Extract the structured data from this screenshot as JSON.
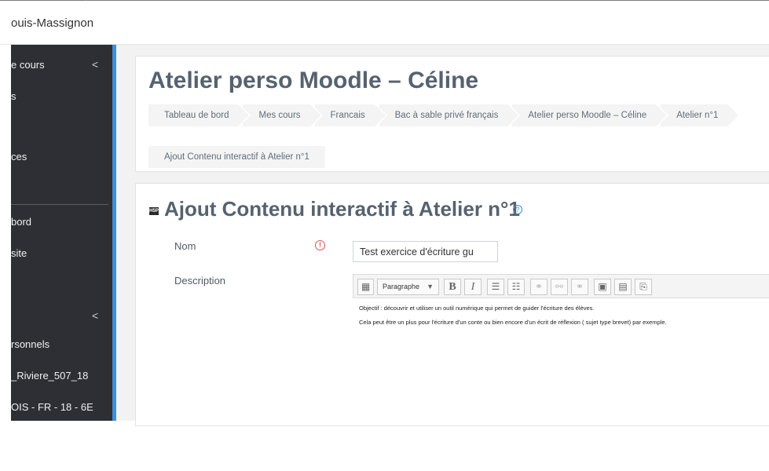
{
  "header": {
    "site_name": "ouis-Massignon"
  },
  "sidebar": {
    "items": [
      {
        "label": "e cours",
        "has_chevron": true
      },
      {
        "label": "s"
      },
      {
        "label": "ces"
      },
      {
        "label": "bord"
      },
      {
        "label": "site"
      },
      {
        "label": "",
        "has_chevron": true
      },
      {
        "label": "rsonnels"
      },
      {
        "label": "_Riviere_507_18"
      },
      {
        "label": "OIS - FR - 18 - 6E"
      }
    ],
    "chevron_symbol": "<",
    "accent_color": "#3d8fd8",
    "background_color": "#2d2f34"
  },
  "course": {
    "title": "Atelier perso Moodle – Céline",
    "breadcrumb": [
      "Tableau de bord",
      "Mes cours",
      "Francais",
      "Bac à sable privé français",
      "Atelier perso Moodle – Céline",
      "Atelier n°1"
    ],
    "breadcrumb_current": "Ajout Contenu interactif à Atelier n°1"
  },
  "form": {
    "h5p_icon_text": "H5P",
    "title": "Ajout Contenu interactif à Atelier n°1",
    "help_symbol": "?",
    "name_label": "Nom",
    "required_symbol": "!",
    "name_value": "Test exercice d'écriture gu",
    "description_label": "Description",
    "editor": {
      "paragraph_label": "Paragraphe",
      "bold_label": "B",
      "italic_label": "I",
      "icons": [
        "toolbar-toggle-icon",
        "bullet-list-icon",
        "numbered-list-icon",
        "link-icon",
        "unlink-icon",
        "anchor-icon",
        "image-icon",
        "media-icon",
        "manage-files-icon"
      ],
      "lines": [
        "Objectif : découvrir et utiliser un outil numérique qui permet de guider l'écriture des élèves.",
        "Cela peut être un plus pour l'écriture d'un conte ou bien encore d'un écrit de réflexion ( sujet type brevet) par exemple."
      ]
    }
  }
}
